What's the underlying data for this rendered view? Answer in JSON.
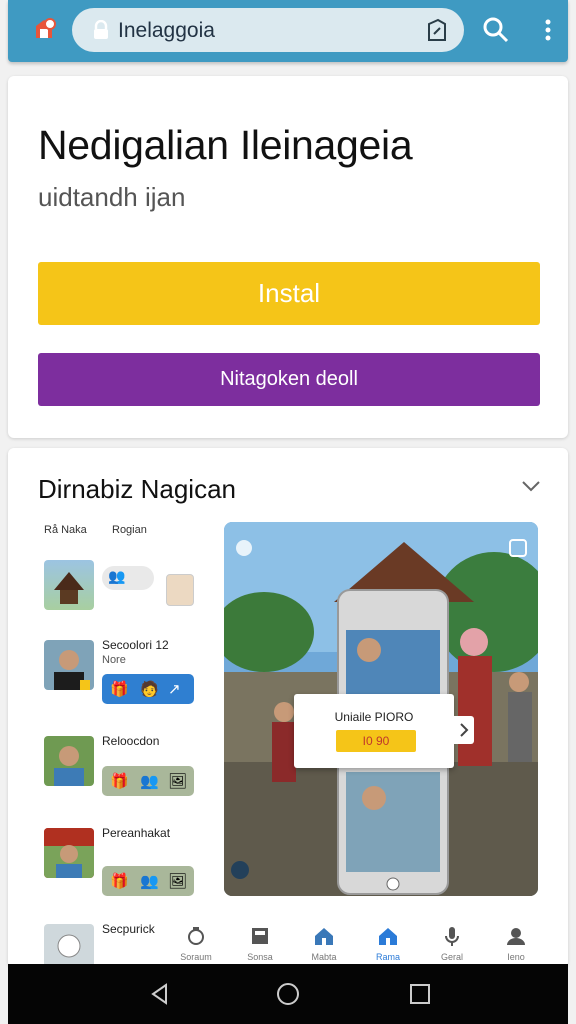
{
  "browser": {
    "url_text": "Inelaggoia",
    "search_icon": "search-icon",
    "menu_icon": "more-vert-icon"
  },
  "hero": {
    "title": "Nedigalian Ileinageia",
    "subtitle": "uidtandh ijan",
    "install_label": "Instal",
    "secondary_label": "Nitagoken deoll"
  },
  "section": {
    "title": "Dirnabiz Nagican",
    "headers": [
      "Rå Naka",
      "Rogian"
    ],
    "rows": [
      {
        "title": "",
        "sub": ""
      },
      {
        "title": "Secoolori 12",
        "sub": "Nore"
      },
      {
        "title": "Reloocdon",
        "sub": ""
      },
      {
        "title": "Pereanhakat",
        "sub": ""
      },
      {
        "title": "Secpurick",
        "sub": ""
      }
    ],
    "popup_title": "Uniaile PIORO",
    "popup_chip": "I0 90"
  },
  "bottom_tabs": [
    {
      "label": "Soraum",
      "icon": "camera-icon"
    },
    {
      "label": "Sonsa",
      "icon": "store-icon"
    },
    {
      "label": "Mabta",
      "icon": "home-icon"
    },
    {
      "label": "Rama",
      "icon": "home-icon"
    },
    {
      "label": "Geral",
      "icon": "mic-icon"
    },
    {
      "label": "Ieno",
      "icon": "user-icon"
    }
  ],
  "colors": {
    "topbar": "#3f9ac2",
    "install": "#f5c518",
    "secondary": "#7d2e9e",
    "accent": "#2b7bd8"
  }
}
